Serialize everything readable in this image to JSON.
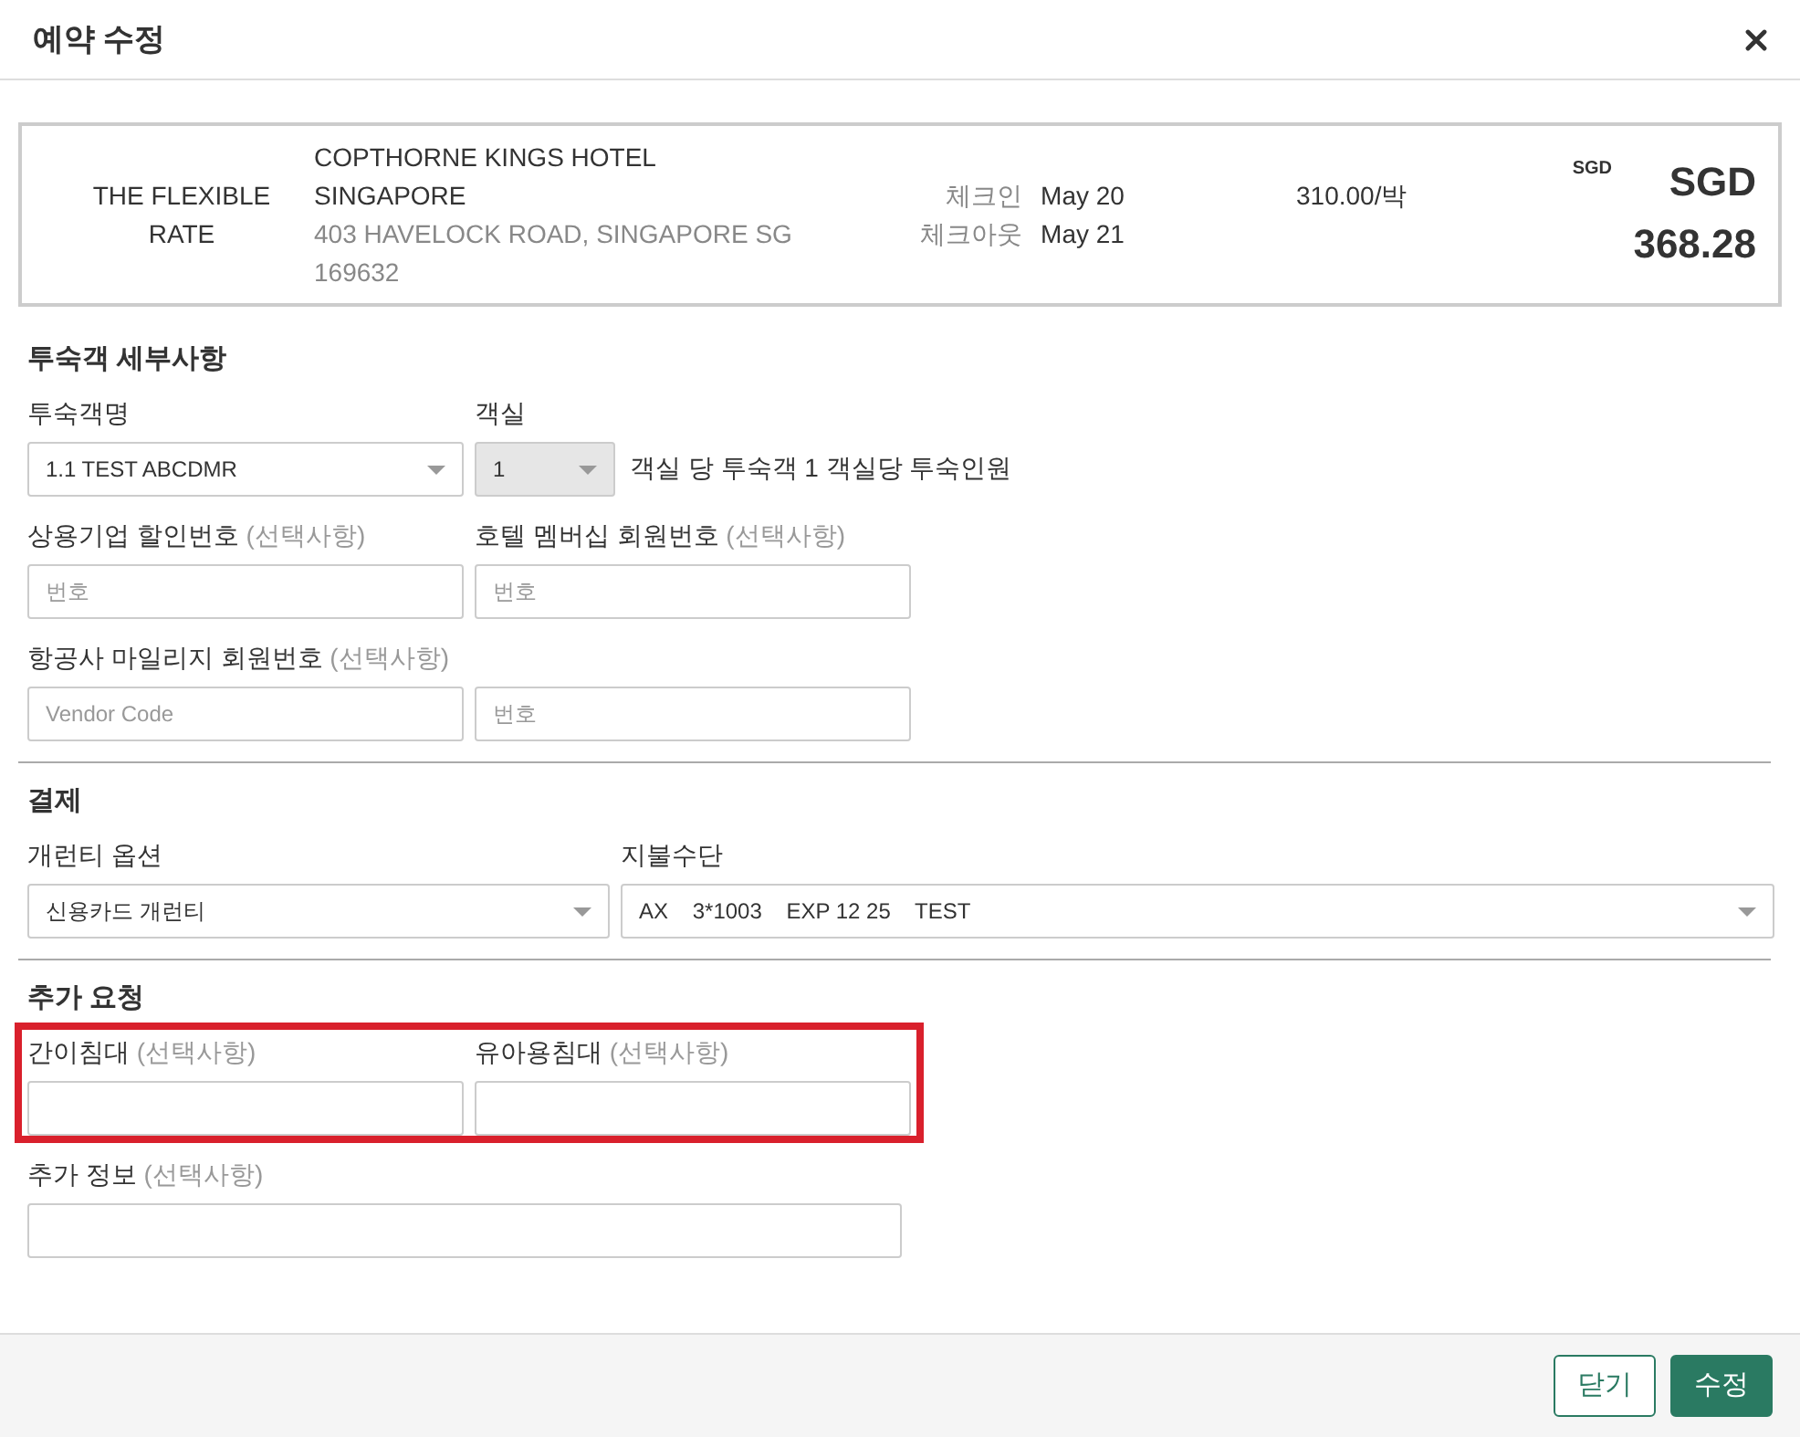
{
  "dialog": {
    "title": "예약 수정"
  },
  "summary": {
    "rate_name": "THE FLEXIBLE RATE",
    "hotel_name": "COPTHORNE KINGS HOTEL SINGAPORE",
    "address": "403 HAVELOCK ROAD, SINGAPORE SG 169632",
    "dates": [
      {
        "label": "체크인",
        "value": "May 20"
      },
      {
        "label": "체크아웃",
        "value": "May 21"
      }
    ],
    "nightly_rate": "310.00/박",
    "currency_code": "SGD",
    "total": "SGD 368.28"
  },
  "sections": [
    {
      "title": "투숙객 세부사항",
      "divider": false,
      "rows": [
        {
          "highlighted": false,
          "fields": [
            {
              "kind": "select",
              "label": "투숙객명",
              "value": "1.1 TEST ABCDMR",
              "disabled": false
            },
            {
              "kind": "select-small",
              "label": "객실",
              "value": "1",
              "disabled": true,
              "note": "객실 당 투숙객 1 객실당 투숙인원"
            }
          ]
        },
        {
          "highlighted": false,
          "fields": [
            {
              "kind": "input",
              "label": "상용기업 할인번호",
              "optional": "(선택사항)",
              "placeholder": "번호"
            },
            {
              "kind": "input",
              "label": "호텔 멤버십 회원번호",
              "optional": "(선택사항)",
              "placeholder": "번호"
            }
          ]
        },
        {
          "highlighted": false,
          "fields": [
            {
              "kind": "input",
              "label": "항공사 마일리지 회원번호",
              "optional": "(선택사항)",
              "placeholder": "Vendor Code"
            },
            {
              "kind": "input",
              "placeholder": "번호"
            }
          ]
        }
      ]
    },
    {
      "title": "결제",
      "divider": true,
      "rows": [
        {
          "highlighted": false,
          "fields": [
            {
              "kind": "select-medium",
              "label": "개런티 옵션",
              "value": "신용카드 개런티",
              "disabled": false
            },
            {
              "kind": "select-wide",
              "label": "지불수단",
              "value": "AX    3*1003    EXP 12 25    TEST",
              "disabled": false
            }
          ]
        }
      ]
    },
    {
      "title": "추가 요청",
      "divider": true,
      "rows": [
        {
          "highlighted": true,
          "fields": [
            {
              "kind": "input",
              "label": "간이침대",
              "optional": "(선택사항)"
            },
            {
              "kind": "input",
              "label": "유아용침대",
              "optional": "(선택사항)"
            }
          ]
        },
        {
          "highlighted": false,
          "fields": [
            {
              "kind": "input-wide",
              "label": "추가 정보",
              "optional": "(선택사항)"
            }
          ]
        }
      ]
    }
  ],
  "buttons": [
    {
      "label": "닫기",
      "kind": "secondary"
    },
    {
      "label": "수정",
      "kind": "primary"
    }
  ]
}
